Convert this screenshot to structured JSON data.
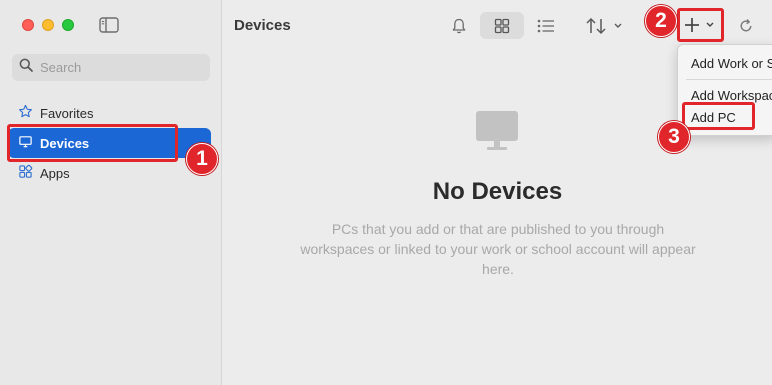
{
  "window": {
    "title": "Devices",
    "traffic_lights": {
      "close": "#ff5f57",
      "minimize": "#febc2e",
      "zoom": "#28c840"
    }
  },
  "sidebar": {
    "search_placeholder": "Search",
    "items": [
      {
        "label": "Favorites",
        "icon": "star-icon",
        "active": false
      },
      {
        "label": "Devices",
        "icon": "monitor-icon",
        "active": true
      },
      {
        "label": "Apps",
        "icon": "apps-icon",
        "active": false
      }
    ],
    "accent": "#1c67d6"
  },
  "toolbar": {
    "icons": [
      "bell-icon",
      "grid-view-icon",
      "list-view-icon",
      "sort-icon",
      "add-icon",
      "refresh-icon"
    ]
  },
  "main": {
    "empty_title": "No Devices",
    "empty_desc": "PCs that you add or that are published to you through workspaces or linked to your work or school account will appear here."
  },
  "add_menu": {
    "items": [
      {
        "label": "Add Work or School Account"
      },
      {
        "label": "Add Workspace"
      },
      {
        "label": "Add PC"
      }
    ]
  },
  "annotations": {
    "color": "#e0262b",
    "steps": [
      "1",
      "2",
      "3"
    ]
  }
}
